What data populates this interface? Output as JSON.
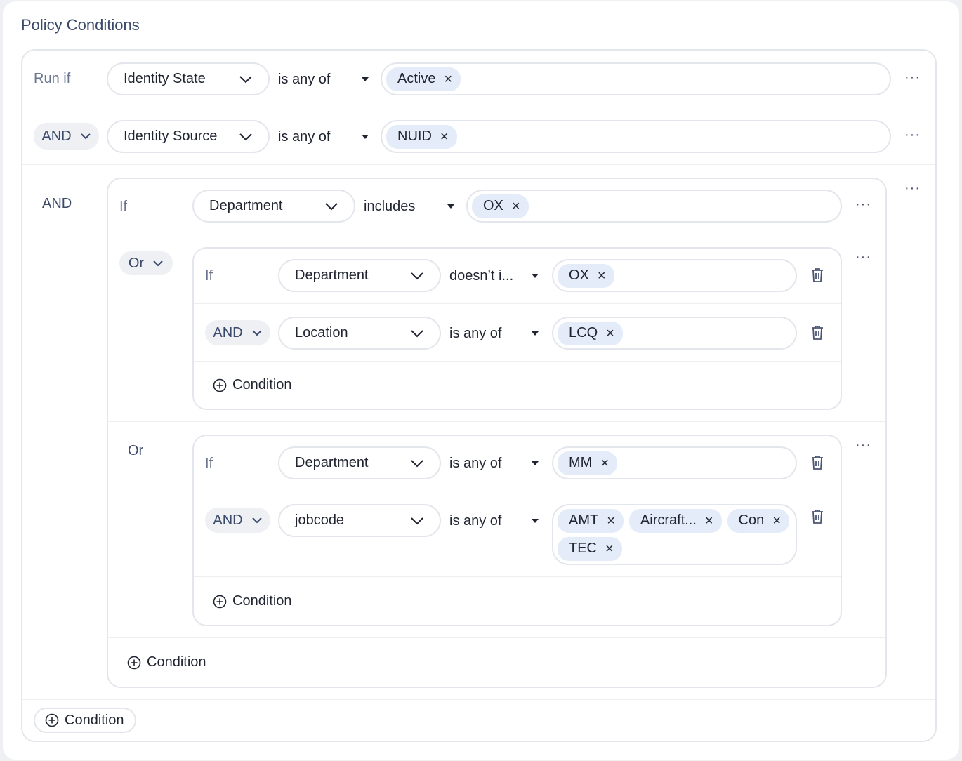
{
  "title": "Policy Conditions",
  "labels": {
    "run_if": "Run if",
    "and": "AND",
    "or": "Or",
    "if": "If"
  },
  "rows": [
    {
      "field": "Identity State",
      "operator": "is any of",
      "values": [
        "Active"
      ]
    },
    {
      "field": "Identity Source",
      "operator": "is any of",
      "values": [
        "NUID"
      ]
    }
  ],
  "group": {
    "first": {
      "field": "Department",
      "operator": "includes",
      "values": [
        "OX"
      ]
    },
    "sub1": [
      {
        "field": "Department",
        "operator": "doesn’t i...",
        "values": [
          "OX"
        ]
      },
      {
        "field": "Location",
        "operator": "is any of",
        "values": [
          "LCQ"
        ]
      }
    ],
    "sub2": [
      {
        "field": "Department",
        "operator": "is any of",
        "values": [
          "MM"
        ]
      },
      {
        "field": "jobcode",
        "operator": "is any of",
        "values": [
          "AMT",
          "Aircraft...",
          "Con",
          "TEC"
        ]
      }
    ]
  },
  "add_condition_label": "Condition",
  "icons": {
    "chip_remove": "×",
    "more": "···",
    "chevron": "chevron-down-icon",
    "caret": "caret-down-icon",
    "trash": "trash-icon",
    "plus": "plus-circle-icon"
  }
}
